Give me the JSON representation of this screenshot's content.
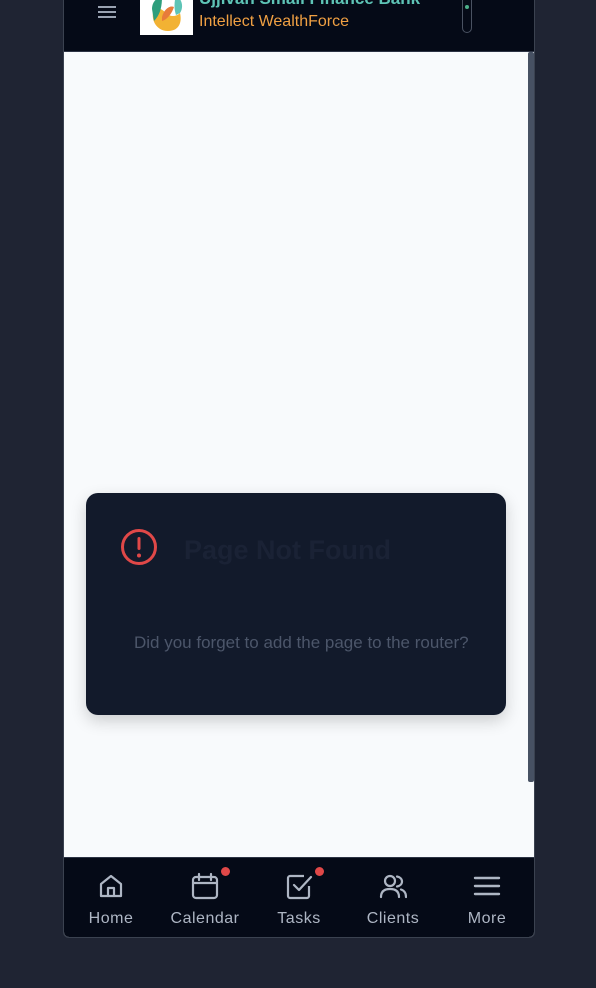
{
  "header": {
    "bank_name": "Ujjivan Small Finance Bank",
    "product_name": "Intellect WealthForce"
  },
  "error_card": {
    "title": "Page Not Found",
    "message": "Did you forget to add the page to the router?"
  },
  "bottom_nav": {
    "items": [
      {
        "label": "Home",
        "icon": "home-icon",
        "badge": false
      },
      {
        "label": "Calendar",
        "icon": "calendar-icon",
        "badge": true
      },
      {
        "label": "Tasks",
        "icon": "tasks-icon",
        "badge": true
      },
      {
        "label": "Clients",
        "icon": "clients-icon",
        "badge": false
      },
      {
        "label": "More",
        "icon": "menu-icon",
        "badge": false
      }
    ]
  },
  "colors": {
    "background": "#1f2433",
    "header_bg": "#050a17",
    "bank_name": "#5ec4b6",
    "product_name": "#f0a043",
    "alert": "#e04848",
    "card_bg": "#121a2b",
    "badge": "#e04848"
  }
}
